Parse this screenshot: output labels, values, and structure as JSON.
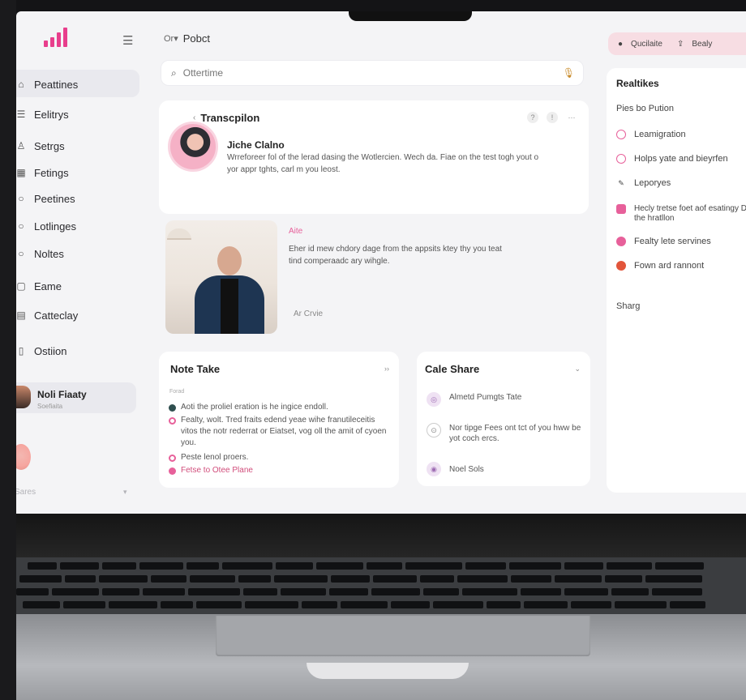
{
  "sidebar": {
    "items": [
      {
        "label": "Peattines",
        "icon": "home-icon"
      },
      {
        "label": "Eelitrys",
        "icon": "list-icon"
      },
      {
        "label": "Setrgs",
        "icon": "user-icon"
      },
      {
        "label": "Fetings",
        "icon": "calendar-icon"
      },
      {
        "label": "Peetines",
        "icon": "search-icon"
      },
      {
        "label": "Lotlinges",
        "icon": "search-icon"
      },
      {
        "label": "Noltes",
        "icon": "search-icon"
      },
      {
        "label": "Eame",
        "icon": "folder-icon"
      },
      {
        "label": "Catteclay",
        "icon": "grid-icon"
      },
      {
        "label": "Ostiion",
        "icon": "doc-icon"
      }
    ],
    "profile": {
      "name": "Noli Fiaaty",
      "subtitle": "Soefiaita"
    },
    "footer": "Sares"
  },
  "topbar": {
    "lang": "Or▾",
    "title": "Pobct",
    "search_placeholder": "Ottertime"
  },
  "actions": {
    "primary": "Qucilaite",
    "secondary": "Bealy"
  },
  "transcription": {
    "title": "Transcpilon",
    "speaker": "Jiche Clalno",
    "text": "Wrreforeer fol of the lerad dasing the Wotlercien. Wech da. Fiae on the test togh yout o yor appr tghts, carl m you leost."
  },
  "alt": {
    "label": "Aite",
    "text": "Eher id mew chdory dage from the appsits ktey thy you teat tind comperaadc ary wihgle.",
    "tag": "Ar Crvie"
  },
  "note": {
    "title": "Note Take",
    "sub": "Forad",
    "lines": [
      "Aoti the proliel eration is he ingice endoll.",
      "Fealty, wolt. Tred fraits edend yeae wihe franutileceitis vitos the notr rederrat or Eiatset, vog oll the amit of cyoen you.",
      "Peste lenol proers.",
      "Fetse to Otee Plane"
    ]
  },
  "share": {
    "title": "Cale Share",
    "items": [
      "Almetd Pumgts Tate",
      "Nor tipge Fees ont tct of you hww be yot coch ercs.",
      "Noel Sols"
    ]
  },
  "realtikes": {
    "title": "Realtikes",
    "subtitle": "Pies bo Pution",
    "items": [
      "Leamigration",
      "Holps yate and bieyrfen",
      "Leporyes",
      "Hecly tretse foet aof esatingy Ds the hratllon",
      "Fealty lete servines",
      "Fown ard rannont"
    ],
    "footer": "Sharg"
  },
  "colors": {
    "accent": "#e83e8c",
    "pill": "#f7dde3"
  }
}
